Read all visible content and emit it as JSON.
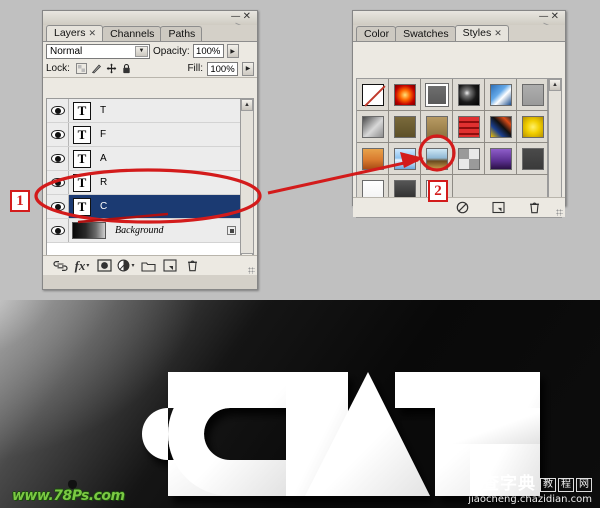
{
  "window": {
    "minimize_label": "—",
    "close_label": "✕"
  },
  "layers_panel": {
    "title": "Layers",
    "tabs": [
      {
        "label": "Layers",
        "closable": true,
        "active": true
      },
      {
        "label": "Channels",
        "closable": false,
        "active": false
      },
      {
        "label": "Paths",
        "closable": false,
        "active": false
      }
    ],
    "blend_mode": "Normal",
    "opacity_label": "Opacity:",
    "opacity_value": "100%",
    "lock_label": "Lock:",
    "lock_icons": [
      "lock-transparent-pixels-icon",
      "lock-image-pixels-icon",
      "lock-position-icon",
      "lock-all-icon"
    ],
    "fill_label": "Fill:",
    "fill_value": "100%",
    "layers": [
      {
        "name": "T",
        "type": "text",
        "visible": true,
        "selected": false
      },
      {
        "name": "F",
        "type": "text",
        "visible": true,
        "selected": false
      },
      {
        "name": "A",
        "type": "text",
        "visible": true,
        "selected": false
      },
      {
        "name": "R",
        "type": "text",
        "visible": true,
        "selected": false
      },
      {
        "name": "C",
        "type": "text",
        "visible": true,
        "selected": true
      },
      {
        "name": "Background",
        "type": "background",
        "visible": true,
        "selected": false,
        "locked": true
      }
    ],
    "thumb_glyph": "T",
    "footer_icons": [
      "link-layers-icon",
      "add-layer-style-icon",
      "add-layer-mask-icon",
      "new-adjustment-layer-icon",
      "new-group-icon",
      "new-layer-icon",
      "delete-layer-icon"
    ],
    "selected_color": "#1b3a72"
  },
  "styles_panel": {
    "tabs": [
      {
        "label": "Color",
        "closable": false,
        "active": false
      },
      {
        "label": "Swatches",
        "closable": false,
        "active": false
      },
      {
        "label": "Styles",
        "closable": true,
        "active": true
      }
    ],
    "swatches": [
      {
        "id": "none",
        "kind": "none",
        "selected": false
      },
      {
        "id": "red-glow",
        "css": "radial-gradient(circle at 50% 50%, #ffe27a 0%, #ff6a00 35%, #c00000 70%, #7a0000 100%)",
        "selected": false
      },
      {
        "id": "gray-button",
        "css": "linear-gradient(#6e6e6e,#5a5a5a)",
        "selected": true
      },
      {
        "id": "dark-swirl",
        "css": "radial-gradient(circle at 40% 40%, #f0f0f0 0%, #7a7a7a 18%, #1a1a1a 55%, #000 100%)",
        "selected": false
      },
      {
        "id": "blue-sky",
        "css": "linear-gradient(135deg,#2e6fb7 0%,#63a8e8 40%,#ffffff 60%,#1d4f8f 100%)",
        "selected": false
      },
      {
        "id": "flat-gray",
        "css": "linear-gradient(#adadad,#9a9a9a)",
        "selected": false
      },
      {
        "id": "gray-fade",
        "css": "linear-gradient(135deg,#4a4a4a 0%,#d8d8d8 55%,#8d8d8d 100%)",
        "selected": false
      },
      {
        "id": "olive-brown",
        "css": "linear-gradient(#7a6a3c,#5d5028)",
        "selected": false
      },
      {
        "id": "tan-gold",
        "css": "linear-gradient(#b79a63,#8e7440)",
        "selected": false
      },
      {
        "id": "red-stripes",
        "css": "repeating-linear-gradient(#e03030 0 4px,#8e0d0d 4px 6px)",
        "selected": false
      },
      {
        "id": "abstract-art",
        "css": "linear-gradient(45deg,#f2c200 0%,#1b3f8f 30%,#111 55%,#d94a17 80%,#2b2b2b 100%)",
        "selected": false
      },
      {
        "id": "yellow-satin",
        "css": "radial-gradient(circle at 50% 50%, #fff06a 0%, #f2cf00 45%, #b79100 100%)",
        "selected": false
      },
      {
        "id": "orange-sunset",
        "css": "linear-gradient(#e8a24a 0%,#d97a2e 55%,#a84d15 100%)",
        "selected": false
      },
      {
        "id": "light-blue-gloss",
        "css": "linear-gradient(#cfe8ff 0%,#8fc4f0 45%,#e8f4ff 55%,#6aa8dd 100%)",
        "selected": false
      },
      {
        "id": "horizon",
        "css": "linear-gradient(#cfe8f5 0%,#8fb8d4 45%,#6b4a1e 60%,#c99a4a 100%)",
        "selected": false
      },
      {
        "id": "noise-texture",
        "css": "repeating-conic-gradient(#e8e8e8 0% 25%, #9a9a9a 0% 50%)",
        "selected": false
      },
      {
        "id": "purple-block",
        "css": "linear-gradient(#8e5ec9 0%,#5a2f8f 60%,#2b1147 100%)",
        "selected": false
      },
      {
        "id": "charcoal",
        "css": "linear-gradient(#4a4a4a,#3a3a3a)",
        "selected": false
      },
      {
        "id": "white-plain",
        "css": "linear-gradient(#ffffff,#f2f2f2)",
        "selected": false
      },
      {
        "id": "dark-gradient",
        "css": "linear-gradient(#555555,#2a2a2a)",
        "selected": false
      },
      {
        "id": "white-black-diagonal",
        "css": "linear-gradient(135deg,#ffffff 0%,#f4f4f4 42%,#2a2a2a 58%,#000000 100%)",
        "selected": false,
        "highlighted": true
      }
    ],
    "footer_icons": [
      "clear-style-icon",
      "new-style-icon",
      "delete-style-icon"
    ]
  },
  "annotations": {
    "step_1": "1",
    "step_2": "2",
    "highlight_color": "#d31b1b"
  },
  "artwork": {
    "text": "CRAFT",
    "letters": [
      "C",
      "R",
      "A",
      "F",
      "T"
    ],
    "text_color": "#ffffff",
    "background_description": "dark gray radial gradient"
  },
  "watermarks": {
    "left": "www.78Ps.com",
    "right_cn_big": "查字典",
    "right_cn_boxed": [
      "教",
      "程",
      "网"
    ],
    "right_url": "jiaocheng.chazidian.com"
  }
}
